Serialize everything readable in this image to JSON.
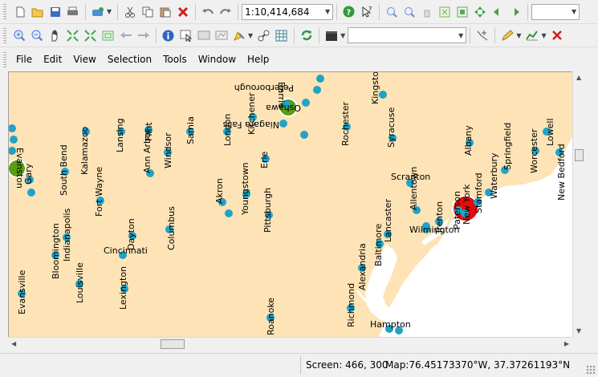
{
  "toolbar": {
    "scale": "1:10,414,684",
    "layer_combo": "",
    "extra_combo": ""
  },
  "menu": [
    "File",
    "Edit",
    "View",
    "Selection",
    "Tools",
    "Window",
    "Help"
  ],
  "status": {
    "screen": "Screen: 466, 300",
    "map": "Map:76.45173370°W, 37.37261193°N"
  },
  "colors": {
    "land": "#fde3b5",
    "water": "#ffffff",
    "city_small": "#1fa3c8",
    "city_medium": "#5a9d12",
    "city_large": "#e50b0b"
  },
  "cities": [
    {
      "name": "Barrie"
    },
    {
      "name": "Peterborough"
    },
    {
      "name": "Kingston"
    },
    {
      "name": "Oshawa"
    },
    {
      "name": "Kitchener"
    },
    {
      "name": "Rochester"
    },
    {
      "name": "Niagara Falls"
    },
    {
      "name": "Syracuse"
    },
    {
      "name": "Albany"
    },
    {
      "name": "Worcester"
    },
    {
      "name": "Lowell"
    },
    {
      "name": "Springfield"
    },
    {
      "name": "New Bedford"
    },
    {
      "name": "Waterbury"
    },
    {
      "name": "Stamford"
    },
    {
      "name": "New York"
    },
    {
      "name": "Paterson"
    },
    {
      "name": "Scranton"
    },
    {
      "name": "Allentown"
    },
    {
      "name": "Trenton"
    },
    {
      "name": "Wilmington"
    },
    {
      "name": "Lancaster"
    },
    {
      "name": "Baltimore"
    },
    {
      "name": "Alexandria"
    },
    {
      "name": "Richmond"
    },
    {
      "name": "Hampton"
    },
    {
      "name": "Roanoke"
    },
    {
      "name": "Pittsburgh"
    },
    {
      "name": "Youngstown"
    },
    {
      "name": "Erie"
    },
    {
      "name": "Akron"
    },
    {
      "name": "London"
    },
    {
      "name": "Sarnia"
    },
    {
      "name": "Windsor"
    },
    {
      "name": "Flint"
    },
    {
      "name": "Ann Arbor"
    },
    {
      "name": "Lansing"
    },
    {
      "name": "Kalamazoo"
    },
    {
      "name": "South Bend"
    },
    {
      "name": "Fort Wayne"
    },
    {
      "name": "Gary"
    },
    {
      "name": "Evanston"
    },
    {
      "name": "Indianapolis"
    },
    {
      "name": "Bloomington"
    },
    {
      "name": "Louisville"
    },
    {
      "name": "Evansville"
    },
    {
      "name": "Dayton"
    },
    {
      "name": "Cincinnati"
    },
    {
      "name": "Columbus"
    },
    {
      "name": "Lexington"
    }
  ]
}
